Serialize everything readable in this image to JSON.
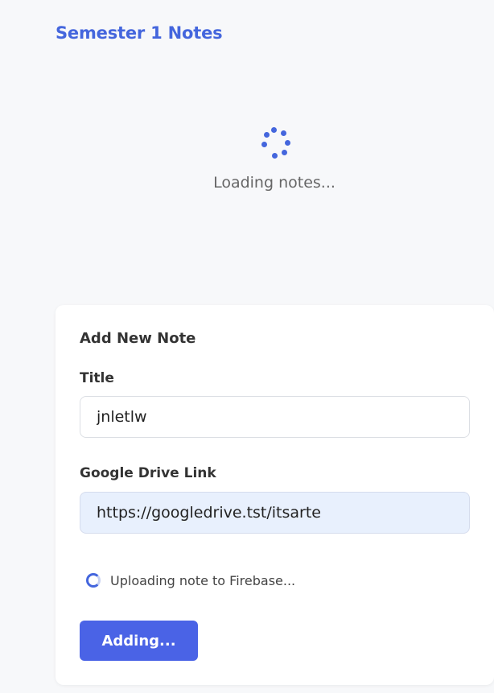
{
  "header": {
    "title": "Semester 1 Notes"
  },
  "loading": {
    "spinner_icon": "dots-spinner-icon",
    "text": "Loading notes..."
  },
  "form": {
    "heading": "Add New Note",
    "title_label": "Title",
    "title_value": "jnletlw",
    "link_label": "Google Drive Link",
    "link_value": "https://googledrive.tst/itsarte",
    "status_icon": "ring-spinner-icon",
    "status_text": "Uploading note to Firebase...",
    "submit_label": "Adding..."
  },
  "colors": {
    "accent": "#4466dd",
    "button": "#4a63e6",
    "background": "#f7f8fa",
    "card": "#ffffff",
    "autofill": "#e8f0fd"
  }
}
